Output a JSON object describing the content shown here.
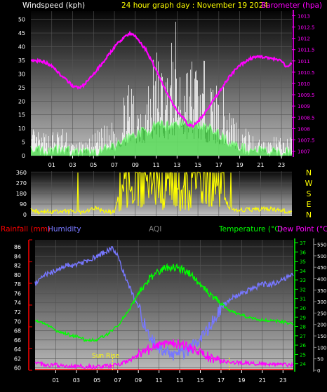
{
  "header": {
    "wind_label": "Windspeed (kph)",
    "title": "24 hour graph day : November 19 2024",
    "baro_label": "Barometer (hpa)"
  },
  "colors": {
    "background": "#000000",
    "wind_axis": "#ffffff",
    "title": "#ffff00",
    "barometer": "#ff00ff",
    "gust": "#ffffff",
    "avg_wind": "#88ff88",
    "wind_fill": "#00cc00",
    "wind_dir": "#ffff00",
    "rainfall": "#ff0000",
    "humidity": "#7777ff",
    "aqi": "#808080",
    "temperature": "#00ff00",
    "dew_point": "#ff00ff",
    "sunrise": "#ffff00"
  },
  "direction_labels": [
    "N",
    "W",
    "S",
    "E",
    "N"
  ],
  "lower_header": {
    "rainfall_label": "Rainfall (mm)",
    "humidity_label": "Humidity",
    "aqi_label": "AQI",
    "temp_label": "Temperature (°C)",
    "dew_label": "Dew Point (°C)"
  },
  "annotations": {
    "sunrise": "Sun Rise"
  },
  "chart_data": [
    {
      "type": "line",
      "title": "24 hour graph day : November 19 2024",
      "xlabel": "",
      "x_ticks": [
        "01",
        "03",
        "05",
        "07",
        "09",
        "11",
        "13",
        "15",
        "17",
        "19",
        "21",
        "23"
      ],
      "x_range_hours": [
        23,
        48
      ],
      "left_axis": {
        "label": "Windspeed (kph)",
        "ticks": [
          0,
          5,
          10,
          15,
          20,
          25,
          30,
          35,
          40,
          45,
          50
        ],
        "ylim": [
          0,
          53
        ]
      },
      "right_axis": {
        "label": "Barometer (hpa)",
        "ticks": [
          1007,
          1007.5,
          1008,
          1008.5,
          1009,
          1009.5,
          1010,
          1010.5,
          1011,
          1011.5,
          1012,
          1012.5,
          1013
        ],
        "ylim": [
          1006.8,
          1013.2
        ]
      },
      "grid": true,
      "series": [
        {
          "name": "Barometer (hpa)",
          "axis": "right",
          "x": [
            23.0,
            24.0,
            25.0,
            26.0,
            27.0,
            27.5,
            28.0,
            29.0,
            30.0,
            31.0,
            32.0,
            32.5,
            33.0,
            34.0,
            35.0,
            36.0,
            37.0,
            38.0,
            38.5,
            39.0,
            40.0,
            41.0,
            42.0,
            43.0,
            44.0,
            45.0,
            46.0,
            47.0,
            47.5,
            48.0
          ],
          "values": [
            1011.0,
            1011.0,
            1010.8,
            1010.3,
            1009.9,
            1009.8,
            1009.9,
            1010.4,
            1011.0,
            1011.6,
            1012.1,
            1012.2,
            1012.1,
            1011.5,
            1010.6,
            1009.6,
            1008.8,
            1008.2,
            1008.1,
            1008.3,
            1008.9,
            1009.6,
            1010.3,
            1010.8,
            1011.1,
            1011.2,
            1011.1,
            1011.0,
            1010.7,
            1010.9
          ]
        },
        {
          "name": "Wind gust (kph)",
          "axis": "left",
          "x": [
            23.0,
            24.0,
            25.0,
            26.0,
            27.0,
            28.0,
            29.0,
            30.0,
            31.0,
            32.0,
            33.0,
            34.0,
            35.0,
            36.0,
            37.0,
            38.0,
            39.0,
            40.0,
            41.0,
            42.0,
            43.0,
            44.0,
            45.0,
            46.0,
            47.0,
            48.0
          ],
          "values": [
            11,
            8,
            10,
            11,
            6,
            5,
            8,
            11,
            14,
            24,
            30,
            30,
            44,
            38,
            52,
            40,
            40,
            32,
            28,
            24,
            12,
            10,
            7,
            7,
            7,
            7
          ]
        },
        {
          "name": "Average wind (kph)",
          "axis": "left",
          "x": [
            23.0,
            24.0,
            25.0,
            26.0,
            27.0,
            28.0,
            29.0,
            30.0,
            31.0,
            32.0,
            33.0,
            34.0,
            35.0,
            36.0,
            37.0,
            38.0,
            39.0,
            40.0,
            41.0,
            42.0,
            43.0,
            44.0,
            45.0,
            46.0,
            47.0,
            48.0
          ],
          "values": [
            3,
            2,
            2,
            3,
            1,
            1,
            1,
            2,
            3,
            6,
            8,
            9,
            11,
            11,
            12,
            12,
            11,
            10,
            8,
            5,
            3,
            2,
            2,
            1,
            1,
            2
          ]
        }
      ]
    },
    {
      "type": "scatter",
      "title": "",
      "xlabel": "",
      "ylabel": "",
      "x_range_hours": [
        23,
        48
      ],
      "left_axis": {
        "ticks": [
          0,
          90,
          180,
          270,
          360
        ],
        "ylim": [
          0,
          360
        ]
      },
      "grid": true,
      "series": [
        {
          "name": "Wind direction (deg)",
          "x": [
            23.0,
            24.0,
            25.0,
            26.0,
            27.0,
            28.0,
            29.0,
            30.0,
            31.0,
            32.0,
            33.0,
            34.0,
            35.0,
            36.0,
            37.0,
            38.0,
            39.0,
            40.0,
            41.0,
            42.0,
            43.0,
            44.0,
            45.0,
            46.0,
            47.0,
            48.0
          ],
          "values": [
            40,
            20,
            25,
            30,
            25,
            20,
            60,
            25,
            25,
            360,
            200,
            350,
            300,
            360,
            280,
            340,
            300,
            340,
            250,
            60,
            40,
            40,
            45,
            50,
            30,
            30
          ]
        }
      ]
    },
    {
      "type": "line",
      "title": "",
      "xlabel": "",
      "x_ticks": [
        "01",
        "03",
        "05",
        "07",
        "09",
        "11",
        "13",
        "15",
        "17",
        "19",
        "21",
        "23"
      ],
      "x_range_hours": [
        23,
        48
      ],
      "left_axis": {
        "label": "Humidity",
        "ticks": [
          60,
          62,
          64,
          66,
          68,
          70,
          72,
          74,
          76,
          78,
          80,
          82,
          84,
          86
        ],
        "ylim": [
          59.5,
          87.5
        ]
      },
      "right_axis": {
        "label": "Temperature (°C)",
        "ticks": [
          24,
          25,
          26,
          27,
          28,
          29,
          30,
          31,
          32,
          33,
          34,
          35,
          36,
          37
        ],
        "ylim": [
          23.3,
          37.3
        ]
      },
      "aqi_axis": {
        "label": "AQI",
        "ticks": [
          0,
          50,
          100,
          150,
          200,
          250,
          300,
          350,
          400,
          450,
          500,
          550
        ],
        "ylim": [
          0,
          570
        ]
      },
      "grid": true,
      "series": [
        {
          "name": "Humidity",
          "axis": "left",
          "x": [
            23.0,
            24.0,
            25.0,
            26.0,
            27.0,
            28.0,
            29.0,
            30.0,
            30.5,
            31.0,
            32.0,
            33.0,
            34.0,
            35.0,
            36.0,
            37.0,
            38.0,
            39.0,
            40.0,
            41.0,
            42.0,
            43.0,
            44.0,
            45.0,
            46.0,
            47.0,
            48.0
          ],
          "values": [
            78,
            80,
            81,
            82,
            82,
            83,
            84,
            85,
            86,
            84,
            78,
            73,
            67,
            64,
            63,
            63,
            64,
            66,
            69,
            73,
            75,
            76,
            77,
            78,
            78,
            79,
            80
          ]
        },
        {
          "name": "Temperature (°C)",
          "axis": "right",
          "x": [
            23.0,
            24.0,
            25.0,
            26.0,
            27.0,
            28.0,
            29.0,
            30.0,
            31.0,
            32.0,
            33.0,
            34.0,
            35.0,
            36.0,
            37.0,
            38.0,
            39.0,
            40.0,
            41.0,
            42.0,
            43.0,
            44.0,
            45.0,
            46.0,
            47.0,
            48.0
          ],
          "values": [
            28.8,
            28.2,
            27.6,
            27.2,
            26.9,
            26.5,
            26.6,
            27.2,
            28.1,
            29.6,
            31.5,
            33.1,
            34.0,
            34.3,
            34.2,
            33.7,
            32.5,
            31.3,
            30.5,
            29.6,
            29.2,
            28.9,
            28.7,
            28.6,
            28.5,
            28.2
          ]
        },
        {
          "name": "AQI",
          "axis": "aqi",
          "x": [
            23.0,
            24.0,
            25.0,
            26.0,
            27.0,
            28.0,
            29.0,
            30.0,
            31.0,
            32.0,
            33.0,
            34.0,
            35.0,
            36.0,
            37.0,
            38.0,
            39.0,
            40.0,
            41.0,
            42.0,
            43.0,
            44.0,
            45.0,
            46.0,
            47.0,
            48.0
          ],
          "values": [
            30,
            25,
            22,
            20,
            18,
            16,
            15,
            18,
            25,
            40,
            65,
            90,
            110,
            120,
            115,
            95,
            75,
            55,
            40,
            35,
            32,
            30,
            28,
            26,
            24,
            22
          ]
        }
      ]
    }
  ]
}
